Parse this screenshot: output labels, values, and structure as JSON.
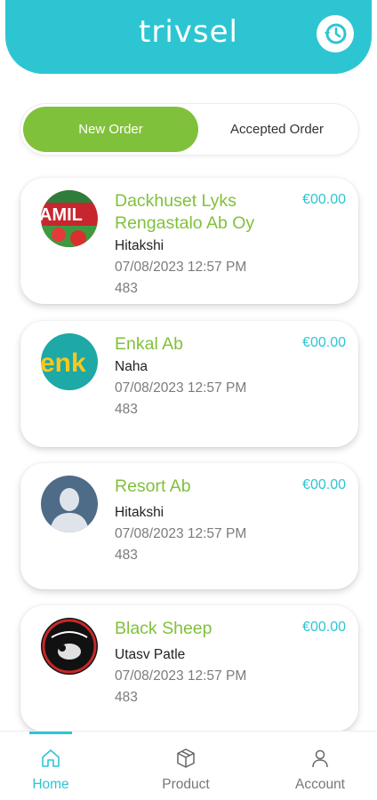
{
  "header": {
    "logo_text": "trivsel",
    "history_icon": "history-icon"
  },
  "tabs": {
    "new_order": "New Order",
    "accepted_order": "Accepted Order"
  },
  "orders": [
    {
      "store": "Dackhuset Lyks Rengastalo Ab Oy",
      "price": "€00.00",
      "customer": "Hitakshi",
      "datetime": "07/08/2023 12:57 PM",
      "order_number": "483",
      "avatar": "amil-logo"
    },
    {
      "store": "Enkal Ab",
      "price": "€00.00",
      "customer": "Naha",
      "datetime": "07/08/2023 12:57 PM",
      "order_number": "483",
      "avatar": "enk-logo"
    },
    {
      "store": "Resort Ab",
      "price": "€00.00",
      "customer": "Hitakshi",
      "datetime": "07/08/2023 12:57 PM",
      "order_number": "483",
      "avatar": "person-placeholder"
    },
    {
      "store": "Black Sheep",
      "price": "€00.00",
      "customer": "Utasv Patle",
      "datetime": "07/08/2023 12:57 PM",
      "order_number": "483",
      "avatar": "black-sheep-logo"
    }
  ],
  "bottom_nav": [
    {
      "label": "Home",
      "icon": "home-icon",
      "active": true
    },
    {
      "label": "Product",
      "icon": "box-icon",
      "active": false
    },
    {
      "label": "Account",
      "icon": "user-icon",
      "active": false
    }
  ],
  "colors": {
    "brand": "#2ec5d3",
    "accent_green": "#80c13b"
  }
}
